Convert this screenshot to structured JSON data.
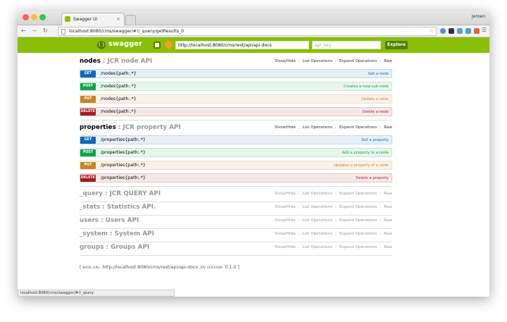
{
  "browser": {
    "tab_title": "Swagger UI",
    "tab_close": "×",
    "user": "Jeroen",
    "address": "localhost:8080/cms/swagger/#!/_query/getResults_0",
    "status_url": "localhost:8080/cms/swagger/#!/_query"
  },
  "swagger": {
    "logo": "swagger",
    "api_url": "http://localhost:8080/cms/rest/api/api-docs",
    "api_key_placeholder": "api_key",
    "explore": "Explore"
  },
  "links": {
    "show_hide": "Show/Hide",
    "list_ops": "List Operations",
    "expand_ops": "Expand Operations",
    "raw": "Raw"
  },
  "resources": [
    {
      "name": "nodes",
      "desc": ": JCR node API",
      "ops": [
        {
          "method": "GET",
          "path": "/nodes{path:.*}",
          "summary": "Get a node"
        },
        {
          "method": "POST",
          "path": "/nodes{path:.*}",
          "summary": "Creates a new sub node"
        },
        {
          "method": "PUT",
          "path": "/nodes{path:.*}",
          "summary": "Update a node"
        },
        {
          "method": "DELETE",
          "path": "/nodes{path:.*}",
          "summary": "Delete a node"
        }
      ]
    },
    {
      "name": "properties",
      "desc": ": JCR property API",
      "ops": [
        {
          "method": "GET",
          "path": "/properties{path:.*}",
          "summary": "Get a property"
        },
        {
          "method": "POST",
          "path": "/properties{path:.*}",
          "summary": "Add a property to a node"
        },
        {
          "method": "PUT",
          "path": "/properties{path:.*}",
          "summary": "Updates a property of a node"
        },
        {
          "method": "DELETE",
          "path": "/properties{path:.*}",
          "summary": "Delete a property"
        }
      ]
    },
    {
      "name": "_query",
      "desc": ": JCR QUERY API"
    },
    {
      "name": "_stats",
      "desc": ": Statistics API."
    },
    {
      "name": "users",
      "desc": ": Users API"
    },
    {
      "name": "_system",
      "desc": ": System API"
    },
    {
      "name": "groups",
      "desc": ": Groups API"
    }
  ],
  "footer": {
    "open": "[",
    "base_label": "BASE URL:",
    "base_url": "http://localhost:8080/cms/rest/api/api-docs",
    "api_label": ", API VERSION:",
    "api_version": "0.1.0",
    "close": "]"
  }
}
